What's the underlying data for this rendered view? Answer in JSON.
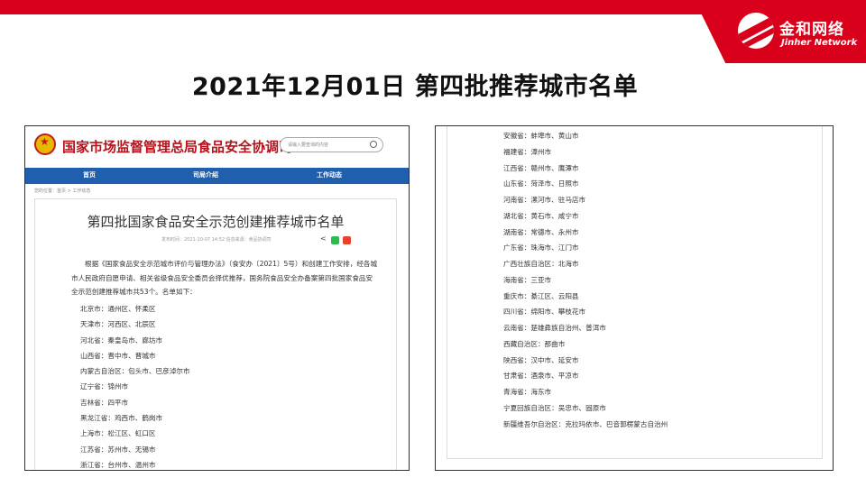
{
  "slide": {
    "title": "2021年12月01日 第四批推荐城市名单"
  },
  "brand": {
    "name_cn": "金和网络",
    "name_en": "Jinher Network",
    "color": "#d9001b"
  },
  "site": {
    "name": "国家市场监督管理总局食品安全协调司",
    "search_placeholder": "请输入要查询的内容",
    "nav": [
      "首页",
      "司局介绍",
      "工作动态"
    ],
    "breadcrumb": "您的位置：首页 > 工作动态",
    "nav_color": "#1f5fae"
  },
  "article": {
    "title": "第四批国家食品安全示范创建推荐城市名单",
    "meta": "发布时间：2021-10-07 14:52    信息来源：食品协调司",
    "body": "根据《国家食品安全示范城市评价与管理办法》（食安办〔2021〕5号）和创建工作安排，经各城市人民政府自愿申请、相关省级食品安全委员会择优推荐，国务院食品安全办备案第四批国家食品安全示范创建推荐城市共53个。名单如下：",
    "list_left": [
      "北京市：通州区、怀柔区",
      "天津市：河西区、北辰区",
      "河北省：秦皇岛市、廊坊市",
      "山西省：晋中市、晋城市",
      "内蒙古自治区：包头市、巴彦淖尔市",
      "辽宁省：锦州市",
      "吉林省：四平市",
      "黑龙江省：鸡西市、鹤岗市",
      "上海市：松江区、虹口区",
      "江苏省：苏州市、无锡市",
      "浙江省：台州市、温州市"
    ],
    "list_right": [
      "安徽省：蚌埠市、黄山市",
      "福建省：漳州市",
      "江西省：赣州市、鹰潭市",
      "山东省：菏泽市、日照市",
      "河南省：漯河市、驻马店市",
      "湖北省：黄石市、咸宁市",
      "湖南省：常德市、永州市",
      "广东省：珠海市、江门市",
      "广西壮族自治区：北海市",
      "海南省：三亚市",
      "重庆市：綦江区、云阳县",
      "四川省：绵阳市、攀枝花市",
      "云南省：楚雄彝族自治州、普洱市",
      "西藏自治区：那曲市",
      "陕西省：汉中市、延安市",
      "甘肃省：酒泉市、平凉市",
      "青海省：海东市",
      "宁夏回族自治区：吴忠市、固原市",
      "新疆维吾尔自治区：克拉玛依市、巴音郭楞蒙古自治州"
    ]
  }
}
